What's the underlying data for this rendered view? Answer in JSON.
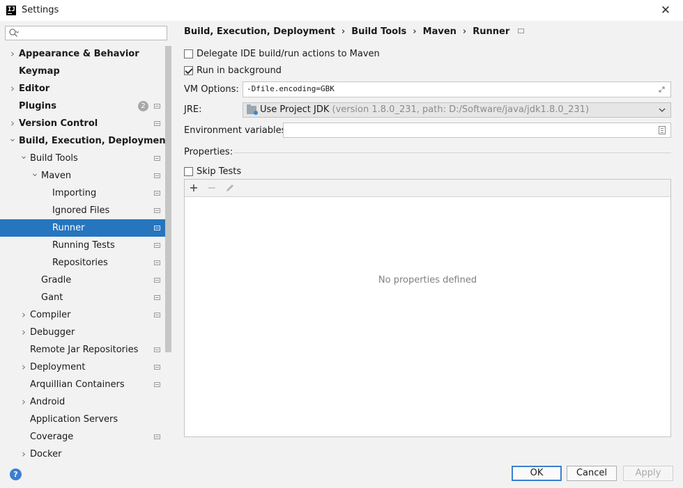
{
  "window": {
    "title": "Settings"
  },
  "search": {
    "placeholder": ""
  },
  "sidebar": {
    "items": [
      {
        "label": "Appearance & Behavior",
        "bold": true,
        "arrow": "right",
        "level": 0,
        "project": false
      },
      {
        "label": "Keymap",
        "bold": true,
        "arrow": "",
        "level": 0,
        "project": false
      },
      {
        "label": "Editor",
        "bold": true,
        "arrow": "right",
        "level": 0,
        "project": false
      },
      {
        "label": "Plugins",
        "bold": true,
        "arrow": "",
        "level": 0,
        "project": true,
        "badge": "2"
      },
      {
        "label": "Version Control",
        "bold": true,
        "arrow": "right",
        "level": 0,
        "project": true
      },
      {
        "label": "Build, Execution, Deployment",
        "bold": true,
        "arrow": "down",
        "level": 0,
        "project": false
      },
      {
        "label": "Build Tools",
        "bold": false,
        "arrow": "down",
        "level": 1,
        "project": true
      },
      {
        "label": "Maven",
        "bold": false,
        "arrow": "down",
        "level": 2,
        "project": true
      },
      {
        "label": "Importing",
        "bold": false,
        "arrow": "",
        "level": 3,
        "project": true
      },
      {
        "label": "Ignored Files",
        "bold": false,
        "arrow": "",
        "level": 3,
        "project": true
      },
      {
        "label": "Runner",
        "bold": false,
        "arrow": "",
        "level": 3,
        "project": true,
        "selected": true
      },
      {
        "label": "Running Tests",
        "bold": false,
        "arrow": "",
        "level": 3,
        "project": true
      },
      {
        "label": "Repositories",
        "bold": false,
        "arrow": "",
        "level": 3,
        "project": true
      },
      {
        "label": "Gradle",
        "bold": false,
        "arrow": "",
        "level": 2,
        "project": true
      },
      {
        "label": "Gant",
        "bold": false,
        "arrow": "",
        "level": 2,
        "project": true
      },
      {
        "label": "Compiler",
        "bold": false,
        "arrow": "right",
        "level": 1,
        "project": true
      },
      {
        "label": "Debugger",
        "bold": false,
        "arrow": "right",
        "level": 1,
        "project": false
      },
      {
        "label": "Remote Jar Repositories",
        "bold": false,
        "arrow": "",
        "level": 1,
        "project": true
      },
      {
        "label": "Deployment",
        "bold": false,
        "arrow": "right",
        "level": 1,
        "project": true
      },
      {
        "label": "Arquillian Containers",
        "bold": false,
        "arrow": "",
        "level": 1,
        "project": true
      },
      {
        "label": "Android",
        "bold": false,
        "arrow": "right",
        "level": 1,
        "project": false
      },
      {
        "label": "Application Servers",
        "bold": false,
        "arrow": "",
        "level": 1,
        "project": false
      },
      {
        "label": "Coverage",
        "bold": false,
        "arrow": "",
        "level": 1,
        "project": true
      },
      {
        "label": "Docker",
        "bold": false,
        "arrow": "right",
        "level": 1,
        "project": false
      }
    ]
  },
  "breadcrumb": [
    "Build, Execution, Deployment",
    "Build Tools",
    "Maven",
    "Runner"
  ],
  "runner": {
    "delegate_label": "Delegate IDE build/run actions to Maven",
    "delegate_checked": false,
    "background_label": "Run in background",
    "background_checked": true,
    "vm_options_label": "VM Options:",
    "vm_options_value": "-Dfile.encoding=GBK",
    "jre_label": "JRE:",
    "jre_value": "Use Project JDK",
    "jre_detail": "(version 1.8.0_231, path: D:/Software/java/jdk1.8.0_231)",
    "env_label": "Environment variables:",
    "env_value": "",
    "properties_label": "Properties:",
    "skip_tests_label": "Skip Tests",
    "skip_tests_checked": false,
    "empty_text": "No properties defined"
  },
  "toolbar": {
    "add": "+",
    "remove": "−"
  },
  "footer": {
    "ok": "OK",
    "cancel": "Cancel",
    "apply": "Apply",
    "help": "?"
  },
  "colors": {
    "selection": "#2675bf",
    "accent": "#3b7fd1"
  }
}
